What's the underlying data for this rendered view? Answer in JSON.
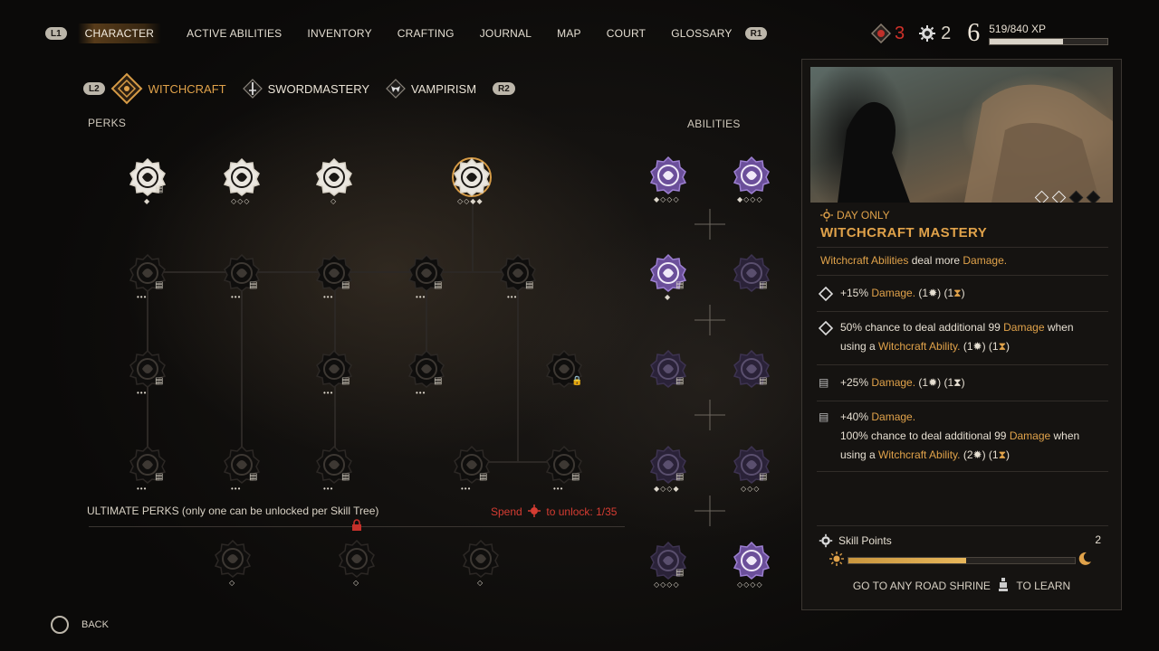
{
  "nav": {
    "left_button": "L1",
    "right_button": "R1",
    "items": [
      "CHARACTER",
      "ACTIVE ABILITIES",
      "INVENTORY",
      "CRAFTING",
      "JOURNAL",
      "MAP",
      "COURT",
      "GLOSSARY"
    ],
    "active": "CHARACTER"
  },
  "currency": {
    "red_points": "3",
    "skill_points": "2",
    "level": "6",
    "xp": "519/840 XP",
    "xp_fraction": 0.62
  },
  "tree_tabs": {
    "left_button": "L2",
    "right_button": "R2",
    "witchcraft": "WITCHCRAFT",
    "swordmastery": "SWORDMASTERY",
    "vampirism": "VAMPIRISM"
  },
  "sections": {
    "perks": "PERKS",
    "abilities": "ABILITIES",
    "ultimate": "ULTIMATE PERKS (only one can be unlocked per Skill Tree)",
    "spend_prefix": "Spend",
    "spend_suffix": "to unlock: 1/35"
  },
  "detail": {
    "day_only": "DAY ONLY",
    "title": "WITCHCRAFT MASTERY",
    "desc_gold": "Witchcraft Abilities",
    "desc_mid": " deal more ",
    "desc_gold2": "Damage.",
    "upgrades": [
      {
        "line1_pre": "+15% ",
        "line1_gold": "Damage.",
        "line1_post": " (1",
        "cost_a": "1",
        "cost_b": "1"
      },
      {
        "line1": "50% chance to deal additional 99 ",
        "line1_gold": "Damage",
        "line1_post": " when",
        "line2_pre": "using a ",
        "line2_gold": "Witchcraft Ability.",
        "cost_a": "1",
        "cost_b": "1"
      },
      {
        "line1_pre": "+25% ",
        "line1_gold": "Damage.",
        "cost_a": "1",
        "cost_b": "1"
      },
      {
        "line1_pre": "+40% ",
        "line1_gold": "Damage.",
        "line2": "100% chance to deal additional 99 ",
        "line2_gold": "Damage",
        "line2_post": " when",
        "line3_pre": "using a ",
        "line3_gold": "Witchcraft Ability.",
        "cost_a": "2",
        "cost_b": "1"
      }
    ],
    "skill_points_label": "Skill Points",
    "skill_points_value": "2",
    "skill_progress_fraction": 0.52,
    "shrine_pre": "GO TO ANY ROAD SHRINE",
    "shrine_post": "TO LEARN"
  },
  "footer": {
    "back": "BACK"
  },
  "colors": {
    "accent": "#e0a24a",
    "lock_red": "#d53c32",
    "ability_purple": "#7d5bb0"
  }
}
